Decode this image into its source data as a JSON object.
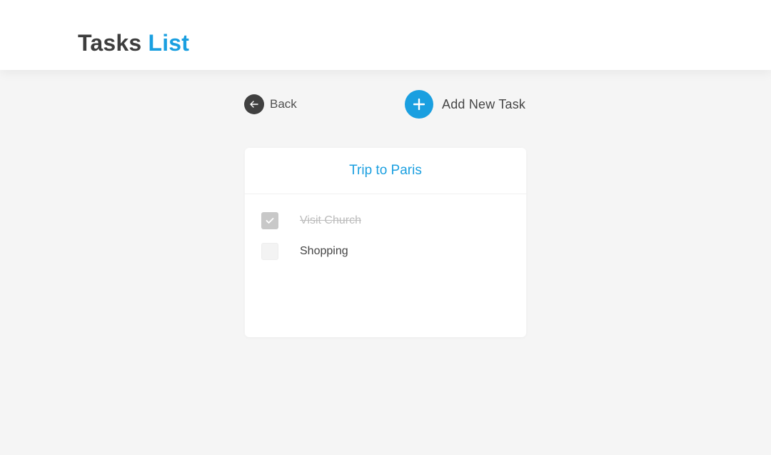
{
  "header": {
    "title_main": "Tasks",
    "title_accent": "List"
  },
  "actions": {
    "back_label": "Back",
    "add_label": "Add New Task"
  },
  "list": {
    "title": "Trip to Paris",
    "tasks": [
      {
        "label": "Visit Church",
        "done": true
      },
      {
        "label": "Shopping",
        "done": false
      }
    ]
  },
  "colors": {
    "accent": "#1a9fe0",
    "dark": "#404040",
    "background": "#f5f5f5"
  },
  "icons": {
    "back": "arrow-left-icon",
    "add": "plus-icon",
    "check": "check-icon"
  }
}
